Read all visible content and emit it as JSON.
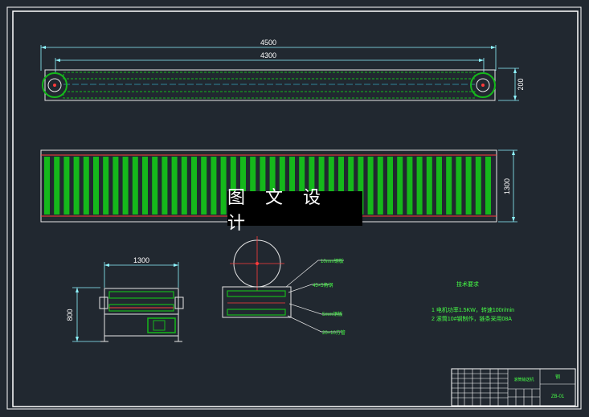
{
  "banner": "图 文 设 计",
  "colors": {
    "background": "#212830",
    "frame": "#ffffff",
    "structure": "#e6e6e6",
    "roller": "#15b81b",
    "chain": "#ff3b3b",
    "accent_cyan": "#40e0ff",
    "text_green": "#46ff46",
    "dimension_cyan": "#8ff4ff"
  },
  "dimensions": {
    "top_overall": "4500",
    "top_inner": "4300",
    "top_height": "200",
    "side_height": "1300",
    "end_width": "1300",
    "end_height": "800"
  },
  "callouts": {
    "c1": "10mm钢板",
    "c2": "45×5角钢",
    "c3": "5mm钢板",
    "c4": "20×10方管"
  },
  "notes": {
    "title": "技术要求",
    "line1": "1  电机功率1.5KW，转速100r/min",
    "line2": "2  滚筒10#钢制作，链条采用08A"
  },
  "title_block": {
    "drawing_name": "滚筒输送机",
    "material": "钢",
    "code": "ZB-01"
  }
}
